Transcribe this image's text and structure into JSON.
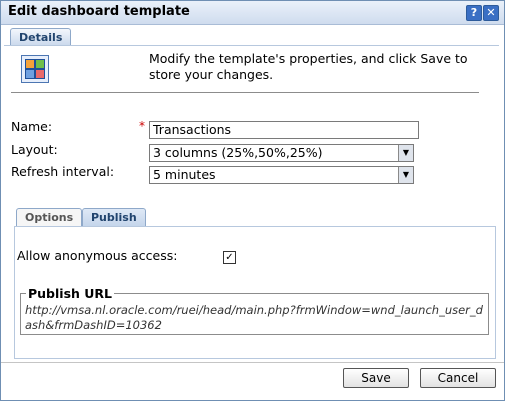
{
  "window": {
    "title": "Edit dashboard template",
    "help_glyph": "?",
    "close_glyph": "✕"
  },
  "tabs": {
    "details": "Details"
  },
  "info": {
    "icon": "dashboard-grid-icon",
    "text": "Modify the template's properties, and click Save to store your changes."
  },
  "form": {
    "name_label": "Name:",
    "required_mark": "*",
    "name_value": "Transactions",
    "layout_label": "Layout:",
    "layout_value": "3 columns (25%,50%,25%)",
    "refresh_label": "Refresh interval:",
    "refresh_value": "5 minutes"
  },
  "inner_tabs": {
    "options": "Options",
    "publish": "Publish"
  },
  "publish": {
    "anonymous_label": "Allow anonymous access:",
    "anonymous_checked": true,
    "check_glyph": "✓",
    "url_legend": "Publish URL",
    "url": "http://vmsa.nl.oracle.com/ruei/head/main.php?frmWindow=wnd_launch_user_dash&frmDashID=10362"
  },
  "buttons": {
    "save": "Save",
    "cancel": "Cancel"
  },
  "colors": {
    "accent": "#3a6fc4",
    "required": "#cc0000"
  }
}
